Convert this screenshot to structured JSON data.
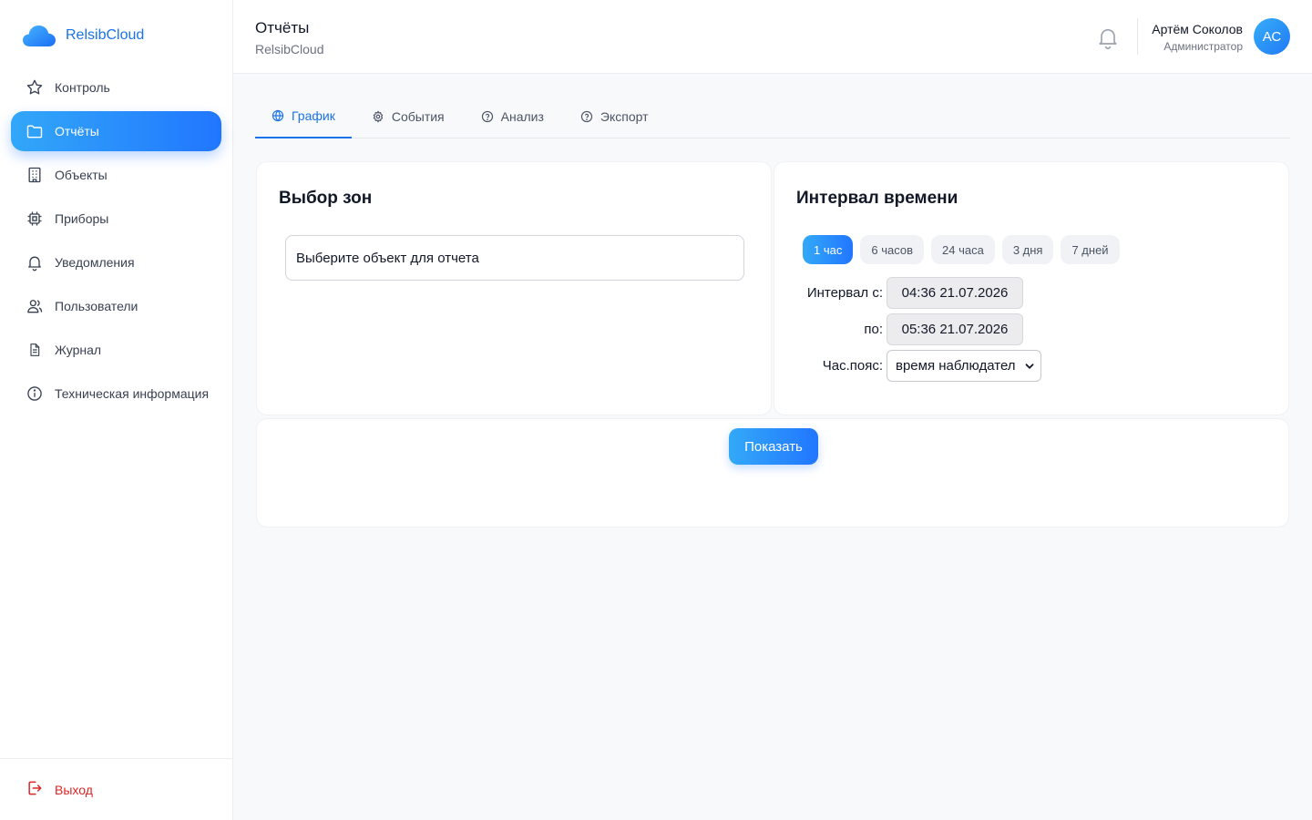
{
  "brand": {
    "name": "RelsibCloud",
    "icon": "cloud-icon",
    "color": "#1a73e8"
  },
  "sidebar": {
    "items": [
      {
        "label": "Контроль",
        "icon": "star-icon",
        "active": false
      },
      {
        "label": "Отчёты",
        "icon": "folder-icon",
        "active": true
      },
      {
        "label": "Объекты",
        "icon": "building-icon",
        "active": false
      },
      {
        "label": "Приборы",
        "icon": "chip-icon",
        "active": false
      },
      {
        "label": "Уведомления",
        "icon": "bell-icon",
        "active": false
      },
      {
        "label": "Пользователи",
        "icon": "users-icon",
        "active": false
      },
      {
        "label": "Журнал",
        "icon": "document-icon",
        "active": false
      },
      {
        "label": "Техническая информация",
        "icon": "info-icon",
        "active": false
      }
    ],
    "logout": {
      "label": "Выход",
      "icon": "logout-icon",
      "color": "#dc2626"
    }
  },
  "header": {
    "title": "Отчёты",
    "subtitle": "RelsibCloud",
    "notifications_icon": "bell-icon",
    "user": {
      "name": "Артём Соколов",
      "role": "Администратор",
      "initials": "АС"
    }
  },
  "tabs": [
    {
      "label": "График",
      "icon": "globe-icon",
      "active": true
    },
    {
      "label": "События",
      "icon": "gear-icon",
      "active": false
    },
    {
      "label": "Анализ",
      "icon": "help-circle-icon",
      "active": false
    },
    {
      "label": "Экспорт",
      "icon": "help-circle-icon",
      "active": false
    }
  ],
  "zones": {
    "title": "Выбор зон",
    "object_placeholder": "Выберите объект для отчета"
  },
  "interval": {
    "title": "Интервал времени",
    "presets": [
      {
        "label": "1 час",
        "active": true
      },
      {
        "label": "6 часов",
        "active": false
      },
      {
        "label": "24 часа",
        "active": false
      },
      {
        "label": "3 дня",
        "active": false
      },
      {
        "label": "7 дней",
        "active": false
      }
    ],
    "from_label": "Интервал с:",
    "from_value": "04:36 21.07.2026",
    "to_label": "по:",
    "to_value": "05:36 21.07.2026",
    "tz_label": "Час.пояс:",
    "tz_value": "время наблюдател"
  },
  "actions": {
    "show_label": "Показать"
  },
  "colors": {
    "accent": "#2176ff",
    "accent_light": "#33a9f7",
    "danger": "#dc2626"
  }
}
